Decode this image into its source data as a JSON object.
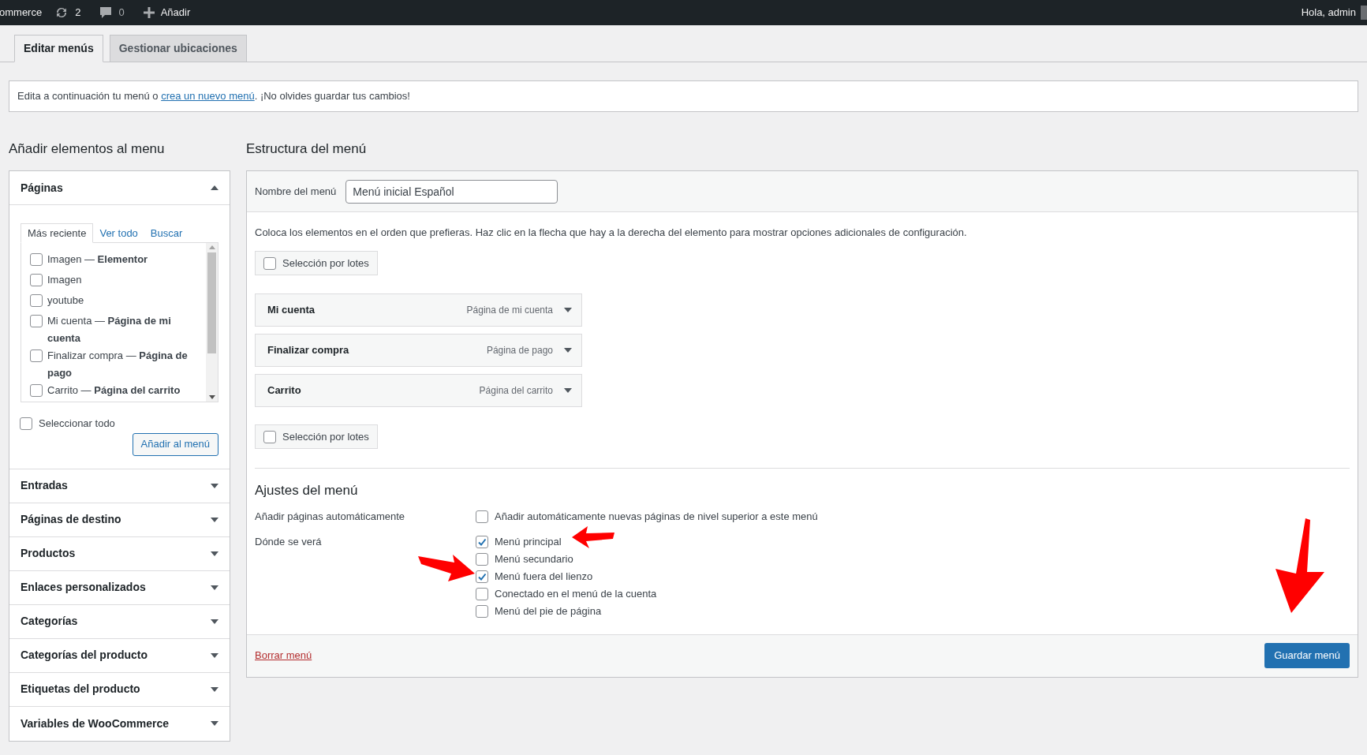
{
  "admin_bar": {
    "site": "ommerce",
    "updates": "2",
    "comments": "0",
    "new": "Añadir",
    "greeting": "Hola, admin"
  },
  "tabs": [
    {
      "label": "Editar menús",
      "selected": true
    },
    {
      "label": "Gestionar ubicaciones",
      "selected": false
    }
  ],
  "notice": {
    "before": "Edita a continuación tu menú o",
    "link": "crea un nuevo menú",
    "after": ". ¡No olvides guardar tus cambios!"
  },
  "left": {
    "title": "Añadir elementos al menu",
    "pages_box": {
      "title": "Páginas",
      "expanded": true,
      "tabs": [
        {
          "label": "Más reciente",
          "selected": true
        },
        {
          "label": "Ver todo",
          "selected": false
        },
        {
          "label": "Buscar",
          "selected": false
        }
      ],
      "items": [
        {
          "label": "Imagen — **Elementor**",
          "checked": false
        },
        {
          "label": "Imagen",
          "checked": false
        },
        {
          "label": "youtube",
          "checked": false
        },
        {
          "label": "Mi cuenta — **Página de mi cuenta**",
          "checked": false
        },
        {
          "label": "Finalizar compra — **Página de pago**",
          "checked": false
        },
        {
          "label": "Carrito — **Página del carrito**",
          "checked": false
        }
      ],
      "select_all": {
        "label": "Seleccionar todo",
        "checked": false
      },
      "add_button": "Añadir al menú"
    },
    "sections": [
      {
        "title": "Entradas",
        "expanded": false
      },
      {
        "title": "Páginas de destino",
        "expanded": false
      },
      {
        "title": "Productos",
        "expanded": false
      },
      {
        "title": "Enlaces personalizados",
        "expanded": false
      },
      {
        "title": "Categorías",
        "expanded": false
      },
      {
        "title": "Categorías del producto",
        "expanded": false
      },
      {
        "title": "Etiquetas del producto",
        "expanded": false
      },
      {
        "title": "Variables de WooCommerce",
        "expanded": false
      }
    ]
  },
  "right": {
    "title": "Estructura del menú",
    "name_label": "Nombre del menú",
    "name_value": "Menú inicial Español",
    "instructions": "Coloca los elementos en el orden que prefieras. Haz clic en la flecha que hay a la derecha del elemento para mostrar opciones adicionales de configuración.",
    "bulk_top": {
      "label": "Selección por lotes",
      "checked": false
    },
    "menu_items": [
      {
        "title": "Mi cuenta",
        "type": "Página de mi cuenta"
      },
      {
        "title": "Finalizar compra",
        "type": "Página de pago"
      },
      {
        "title": "Carrito",
        "type": "Página del carrito"
      }
    ],
    "bulk_bottom": {
      "label": "Selección por lotes",
      "checked": false
    },
    "settings": {
      "title": "Ajustes del menú",
      "auto_label": "Añadir páginas automáticamente",
      "auto_option": {
        "label": "Añadir automáticamente nuevas páginas de nivel superior a este menú",
        "checked": false
      },
      "locations_label": "Dónde se verá",
      "locations": [
        {
          "label": "Menú principal",
          "checked": true
        },
        {
          "label": "Menú secundario",
          "checked": false
        },
        {
          "label": "Menú fuera del lienzo",
          "checked": true
        },
        {
          "label": "Conectado en el menú de la cuenta",
          "checked": false
        },
        {
          "label": "Menú del pie de página",
          "checked": false
        }
      ]
    },
    "delete_link": "Borrar menú",
    "save_button": "Guardar menú"
  }
}
